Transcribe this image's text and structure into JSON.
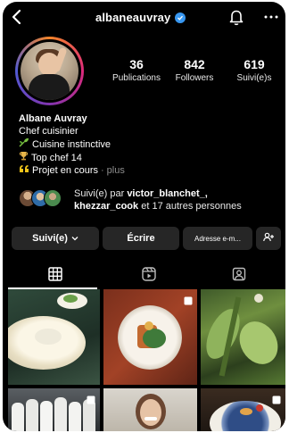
{
  "header": {
    "username": "albaneauvray",
    "verified": true,
    "icons": [
      "back-arrow-icon",
      "verified-badge-icon",
      "bell-icon",
      "more-icon"
    ]
  },
  "stats": {
    "posts": {
      "value": "36",
      "label": "Publications"
    },
    "followers": {
      "value": "842",
      "label": "Followers"
    },
    "following": {
      "value": "619",
      "label": "Suivi(e)s"
    }
  },
  "bio": {
    "name": "Albane Auvray",
    "category": "Chef cuisinier",
    "line1": "Cuisine instinctive",
    "line1_icon": "sprout-icon",
    "line2": "Top chef 14",
    "line2_icon": "trophy-icon",
    "line3": "Projet en cours",
    "line3_icon": "quote-icon",
    "more": "plus"
  },
  "followed_by": {
    "prefix": "Suivi(e) par",
    "user1": "victor_blanchet_,",
    "user2": "khezzar_cook",
    "suffix": "et 17 autres personnes"
  },
  "actions": {
    "follow": "Suivi(e)",
    "message": "Écrire",
    "email": "Adresse e-m...",
    "add_user_icon": "add-user-icon"
  },
  "tabs": [
    "grid-icon",
    "reels-icon",
    "tagged-icon"
  ],
  "colors": {
    "background": "#000000",
    "button": "#262626",
    "verified": "#3897f0",
    "muted": "#8e8e8e"
  }
}
